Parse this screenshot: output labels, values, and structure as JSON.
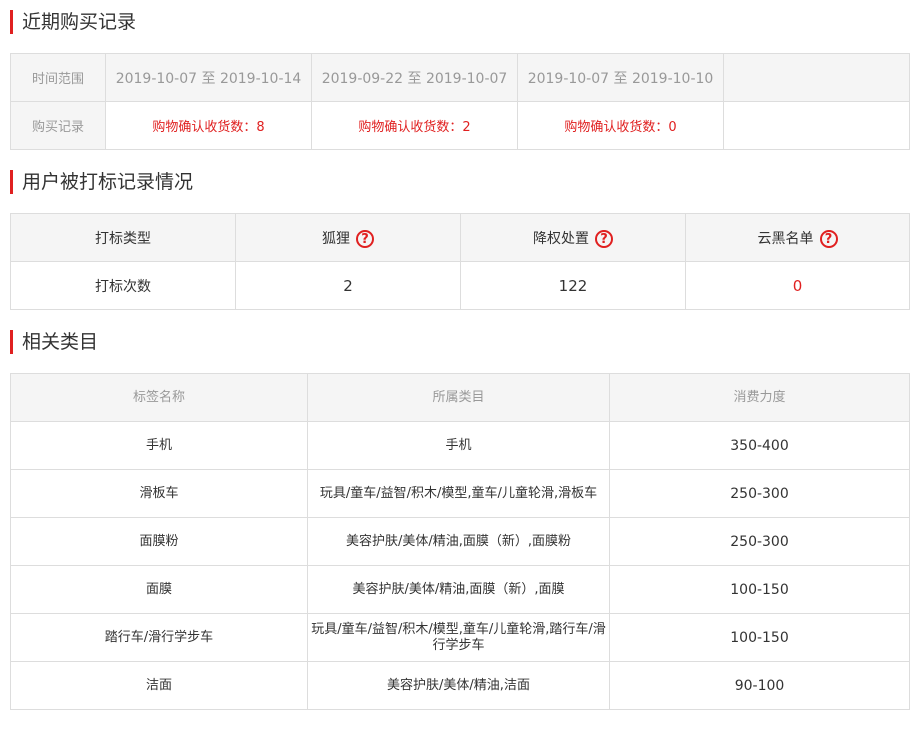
{
  "sections": {
    "purchase_title": "近期购买记录",
    "flags_title": "用户被打标记录情况",
    "category_title": "相关类目"
  },
  "purchase": {
    "row_label_range": "时间范围",
    "row_label_record": "购买记录",
    "ranges": [
      "2019-10-07 至 2019-10-14",
      "2019-09-22 至 2019-10-07",
      "2019-10-07 至 2019-10-10"
    ],
    "records": [
      "购物确认收货数：8",
      "购物确认收货数：2",
      "购物确认收货数：0"
    ]
  },
  "flags": {
    "type_label": "打标类型",
    "count_label": "打标次数",
    "columns": [
      {
        "name": "狐狸",
        "count": "2"
      },
      {
        "name": "降权处置",
        "count": "122"
      },
      {
        "name": "云黑名单",
        "count": "0"
      }
    ]
  },
  "categories": {
    "headers": [
      "标签名称",
      "所属类目",
      "消费力度"
    ],
    "rows": [
      {
        "tag": "手机",
        "category": "手机",
        "spend": "350-400"
      },
      {
        "tag": "滑板车",
        "category": "玩具/童车/益智/积木/模型,童车/儿童轮滑,滑板车",
        "spend": "250-300"
      },
      {
        "tag": "面膜粉",
        "category": "美容护肤/美体/精油,面膜（新）,面膜粉",
        "spend": "250-300"
      },
      {
        "tag": "面膜",
        "category": "美容护肤/美体/精油,面膜（新）,面膜",
        "spend": "100-150"
      },
      {
        "tag": "踏行车/滑行学步车",
        "category": "玩具/童车/益智/积木/模型,童车/儿童轮滑,踏行车/滑行学步车",
        "spend": "100-150"
      },
      {
        "tag": "洁面",
        "category": "美容护肤/美体/精油,洁面",
        "spend": "90-100"
      }
    ]
  },
  "colors": {
    "accent": "#e02020",
    "header_bg": "#f5f5f5",
    "border": "#dddddd",
    "muted_text": "#999999"
  },
  "icons": {
    "help": "question-circle-icon"
  }
}
